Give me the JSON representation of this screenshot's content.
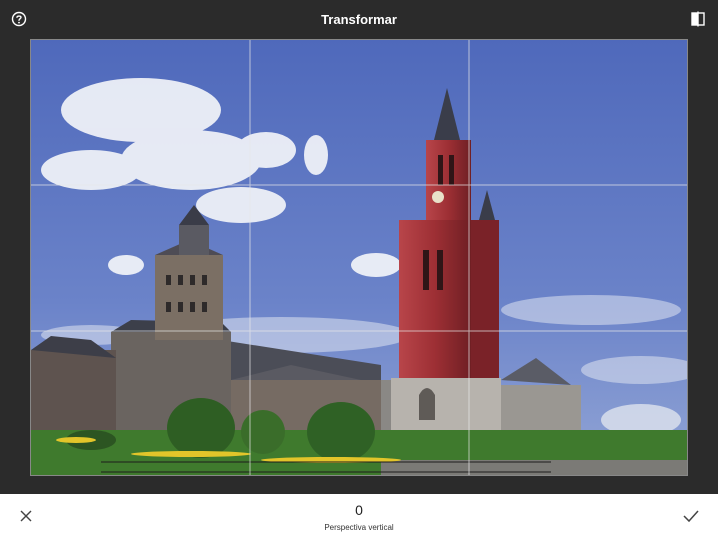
{
  "header": {
    "title": "Transformar"
  },
  "icons": {
    "help": "help-icon",
    "compare": "compare-icon",
    "cancel": "close-icon",
    "apply": "check-icon"
  },
  "adjustment": {
    "value": "0",
    "label": "Perspectiva vertical"
  },
  "colors": {
    "bar_dark": "#2b2b2b",
    "bar_light": "#ffffff",
    "sky": "#5a74c4",
    "tower_red": "#9d2f34",
    "grass": "#3f7a2d"
  }
}
